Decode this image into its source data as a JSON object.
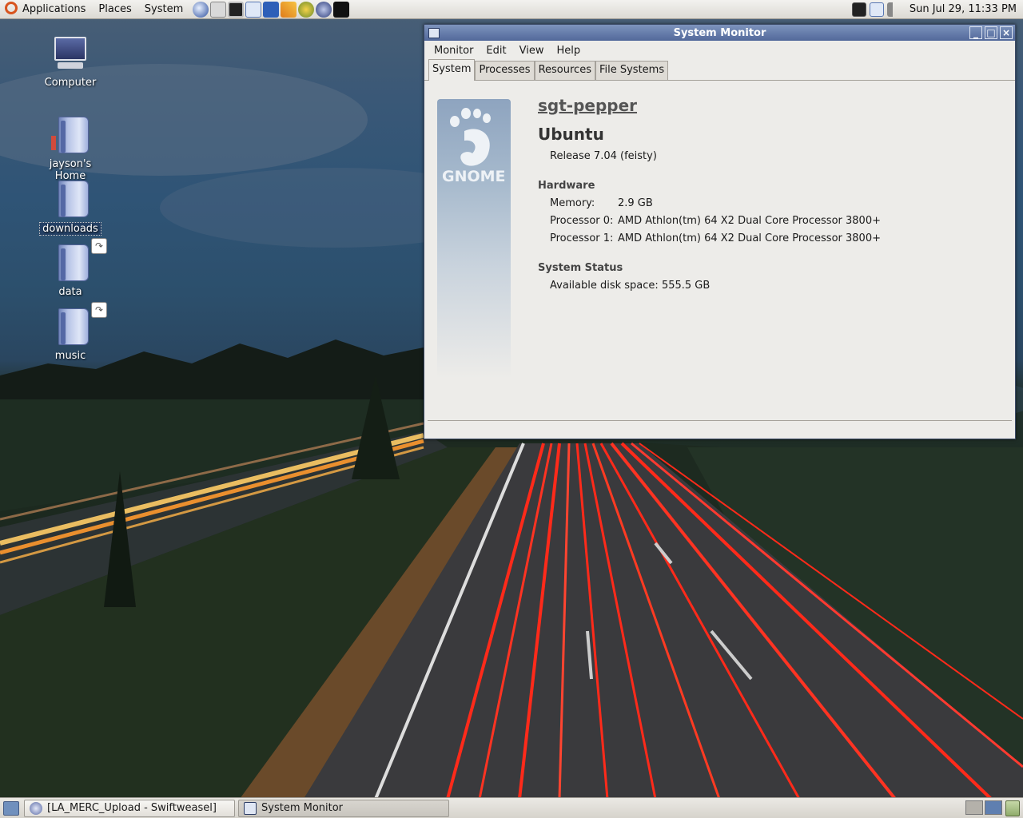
{
  "top_panel": {
    "menus": [
      "Applications",
      "Places",
      "System"
    ],
    "launcher_icons": [
      "firefox-icon",
      "network-icon",
      "terminal-icon",
      "messenger-icon",
      "torrent-icon",
      "tools-icon",
      "globe-icon",
      "music-player-icon",
      "steam-icon"
    ],
    "tray_icons": [
      "network-monitor-icon",
      "chat-icon",
      "volume-icon"
    ],
    "clock": "Sun Jul 29, 11:33 PM"
  },
  "desktop": {
    "icons": [
      {
        "label": "Computer",
        "icon": "computer-icon"
      },
      {
        "label": "jayson's Home",
        "icon": "home-folder-icon"
      },
      {
        "label": "downloads",
        "icon": "folder-icon",
        "selected": true
      },
      {
        "label": "data",
        "icon": "folder-link-icon"
      },
      {
        "label": "music",
        "icon": "folder-link-icon"
      }
    ]
  },
  "window": {
    "title": "System Monitor",
    "menus": [
      "Monitor",
      "Edit",
      "View",
      "Help"
    ],
    "tabs": [
      "System",
      "Processes",
      "Resources",
      "File Systems"
    ],
    "active_tab": "System",
    "system": {
      "logo_text": "GNOME",
      "hostname": "sgt-pepper",
      "distro": "Ubuntu",
      "release": "Release 7.04 (feisty)",
      "hardware_heading": "Hardware",
      "memory_label": "Memory:",
      "memory_value": "2.9 GB",
      "processor0_label": "Processor 0:",
      "processor0_value": "AMD Athlon(tm) 64 X2 Dual Core Processor 3800+",
      "processor1_label": "Processor 1:",
      "processor1_value": "AMD Athlon(tm) 64 X2 Dual Core Processor 3800+",
      "status_heading": "System Status",
      "disk_label": "Available disk space:",
      "disk_value": "555.5 GB"
    }
  },
  "bottom_panel": {
    "tasks": [
      {
        "label": "[LA_MERC_Upload - Swiftweasel]",
        "icon": "swiftweasel-icon"
      },
      {
        "label": "System Monitor",
        "icon": "system-monitor-icon"
      }
    ]
  },
  "colors": {
    "titlebar": "#52689a",
    "panel": "#dcd9d3",
    "window_bg": "#edece9",
    "tail_lights": "#ff2a1a",
    "head_lights": "#ffb347"
  }
}
